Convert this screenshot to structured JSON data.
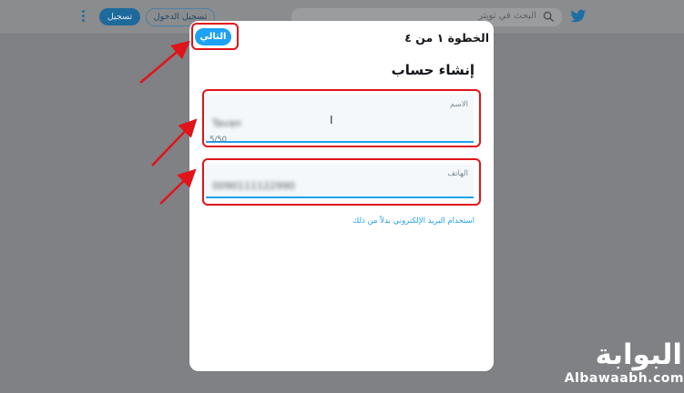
{
  "topbar": {
    "search_placeholder": "البحث في تويتر",
    "login_label": "تسجيل الدخول",
    "signup_label": "تسجيل"
  },
  "modal": {
    "step_label": "الخطوة ١ من ٤",
    "next_label": "التالي",
    "title": "إنشاء حساب",
    "name_field": {
      "label": "الاسم",
      "value": "Tavan",
      "counter": "5/50"
    },
    "phone_field": {
      "label": "الهاتف",
      "value": "0090111122990"
    },
    "use_email_link": "استخدام البريد الإلكتروني بدلاً من ذلك"
  },
  "watermark": {
    "arabic": "البوابة",
    "latin": "Albawaabh.com"
  },
  "colors": {
    "accent": "#1da1f2",
    "highlight": "#e0141a",
    "overlay": "#7f8184"
  }
}
